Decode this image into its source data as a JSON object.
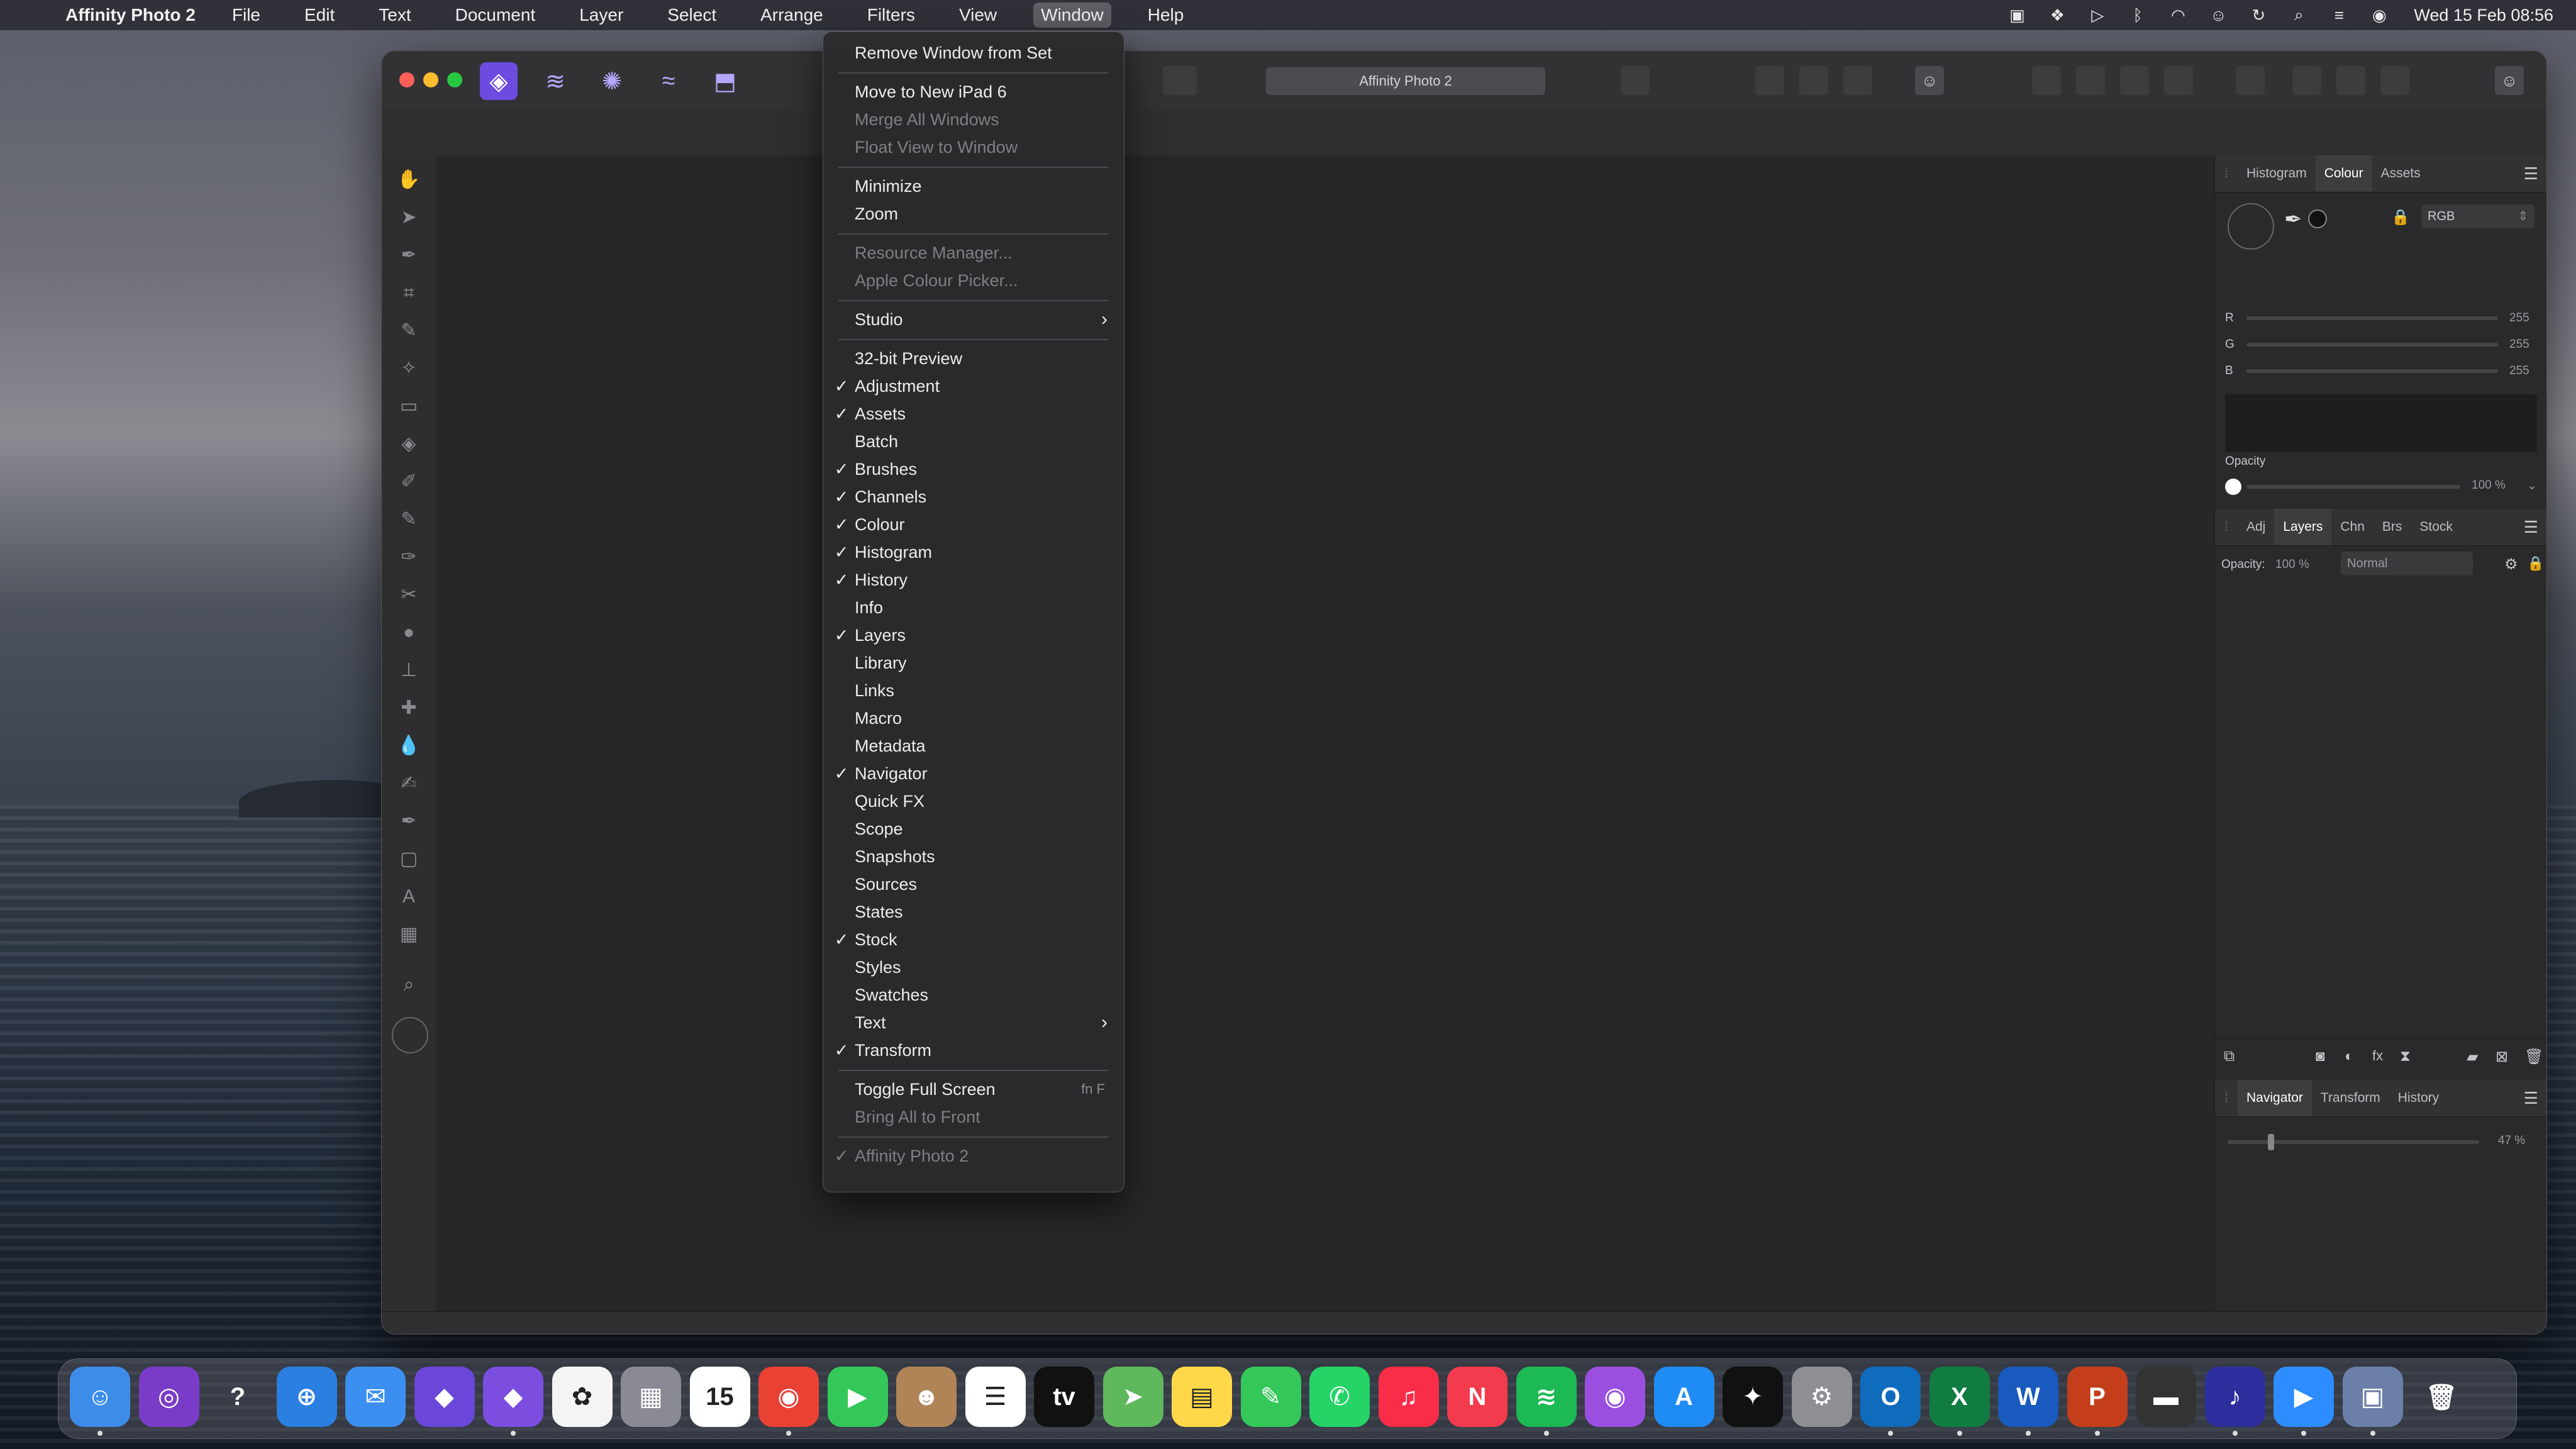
{
  "menubar": {
    "app_name": "Affinity Photo 2",
    "menus": [
      "File",
      "Edit",
      "Text",
      "Document",
      "Layer",
      "Select",
      "Arrange",
      "Filters",
      "View",
      "Window",
      "Help"
    ],
    "open_menu": "Window",
    "clock": "Wed 15 Feb  08:56"
  },
  "window": {
    "title": "Affinity Photo 2"
  },
  "colour_panel": {
    "tabs": [
      "Histogram",
      "Colour",
      "Assets"
    ],
    "selected_tab": "Colour",
    "model": "RGB",
    "channels": [
      {
        "label": "R",
        "value": "255"
      },
      {
        "label": "G",
        "value": "255"
      },
      {
        "label": "B",
        "value": "255"
      }
    ],
    "opacity_label": "Opacity",
    "opacity_value": "100 %"
  },
  "layers_panel": {
    "tabs": [
      "Adj",
      "Layers",
      "Chn",
      "Brs",
      "Stock"
    ],
    "selected_tab": "Layers",
    "opacity_label": "Opacity:",
    "opacity_value": "100 %",
    "blend_mode": "Normal"
  },
  "navigator_panel": {
    "tabs": [
      "Navigator",
      "Transform",
      "History"
    ],
    "selected_tab": "Navigator",
    "zoom": "47 %"
  },
  "window_menu": {
    "items": [
      {
        "label": "Remove Window from Set",
        "checked": false,
        "disabled": false
      },
      {
        "separator": true
      },
      {
        "label": "Move to New iPad 6",
        "checked": false,
        "disabled": false
      },
      {
        "label": "Merge All Windows",
        "checked": false,
        "disabled": true
      },
      {
        "label": "Float View to Window",
        "checked": false,
        "disabled": true
      },
      {
        "separator": true
      },
      {
        "label": "Minimize",
        "checked": false,
        "disabled": false
      },
      {
        "label": "Zoom",
        "checked": false,
        "disabled": false
      },
      {
        "separator": true
      },
      {
        "label": "Resource Manager...",
        "checked": false,
        "disabled": true
      },
      {
        "label": "Apple Colour Picker...",
        "checked": false,
        "disabled": true
      },
      {
        "separator": true
      },
      {
        "label": "Studio",
        "checked": false,
        "disabled": false,
        "submenu": true
      },
      {
        "separator": true
      },
      {
        "label": "32-bit Preview",
        "checked": false,
        "disabled": false
      },
      {
        "label": "Adjustment",
        "checked": true,
        "disabled": false
      },
      {
        "label": "Assets",
        "checked": true,
        "disabled": false
      },
      {
        "label": "Batch",
        "checked": false,
        "disabled": false
      },
      {
        "label": "Brushes",
        "checked": true,
        "disabled": false
      },
      {
        "label": "Channels",
        "checked": true,
        "disabled": false
      },
      {
        "label": "Colour",
        "checked": true,
        "disabled": false
      },
      {
        "label": "Histogram",
        "checked": true,
        "disabled": false
      },
      {
        "label": "History",
        "checked": true,
        "disabled": false
      },
      {
        "label": "Info",
        "checked": false,
        "disabled": false
      },
      {
        "label": "Layers",
        "checked": true,
        "disabled": false
      },
      {
        "label": "Library",
        "checked": false,
        "disabled": false
      },
      {
        "label": "Links",
        "checked": false,
        "disabled": false
      },
      {
        "label": "Macro",
        "checked": false,
        "disabled": false
      },
      {
        "label": "Metadata",
        "checked": false,
        "disabled": false
      },
      {
        "label": "Navigator",
        "checked": true,
        "disabled": false
      },
      {
        "label": "Quick FX",
        "checked": false,
        "disabled": false
      },
      {
        "label": "Scope",
        "checked": false,
        "disabled": false
      },
      {
        "label": "Snapshots",
        "checked": false,
        "disabled": false
      },
      {
        "label": "Sources",
        "checked": false,
        "disabled": false
      },
      {
        "label": "States",
        "checked": false,
        "disabled": false
      },
      {
        "label": "Stock",
        "checked": true,
        "disabled": false
      },
      {
        "label": "Styles",
        "checked": false,
        "disabled": false
      },
      {
        "label": "Swatches",
        "checked": false,
        "disabled": false
      },
      {
        "label": "Text",
        "checked": false,
        "disabled": false,
        "submenu": true
      },
      {
        "label": "Transform",
        "checked": true,
        "disabled": false
      },
      {
        "separator": true
      },
      {
        "label": "Toggle Full Screen",
        "checked": false,
        "disabled": false,
        "shortcut": "fn F"
      },
      {
        "label": "Bring All to Front",
        "checked": false,
        "disabled": true
      },
      {
        "separator": true
      },
      {
        "label": "Affinity Photo 2",
        "checked": true,
        "disabled": true
      }
    ]
  },
  "dock": {
    "items": [
      {
        "name": "finder-icon",
        "color": "#3d8de8",
        "glyph": "☺",
        "running": true
      },
      {
        "name": "siri-icon",
        "color": "#7a3cc8",
        "glyph": "◎",
        "running": false
      },
      {
        "name": "help-icon",
        "color": "transparent",
        "glyph": "?",
        "running": false
      },
      {
        "name": "safari-icon",
        "color": "#2a7fe0",
        "glyph": "⊕",
        "running": false
      },
      {
        "name": "mail-icon",
        "color": "#3b8ff0",
        "glyph": "✉",
        "running": false
      },
      {
        "name": "affinity-designer-icon",
        "color": "#6a47d8",
        "glyph": "◆",
        "running": false
      },
      {
        "name": "affinity-photo-icon",
        "color": "#7b4ee0",
        "glyph": "◆",
        "running": true
      },
      {
        "name": "photos-icon",
        "color": "#f4f4f4",
        "glyph": "✿",
        "running": false
      },
      {
        "name": "launchpad-icon",
        "color": "#8a8a94",
        "glyph": "▦",
        "running": false
      },
      {
        "name": "calendar-icon",
        "color": "#ffffff",
        "glyph": "15",
        "running": false
      },
      {
        "name": "chrome-icon",
        "color": "#e94235",
        "glyph": "◉",
        "running": true
      },
      {
        "name": "facetime-icon",
        "color": "#34c759",
        "glyph": "▶",
        "running": false
      },
      {
        "name": "contacts-icon",
        "color": "#b08457",
        "glyph": "☻",
        "running": false
      },
      {
        "name": "reminders-icon",
        "color": "#ffffff",
        "glyph": "☰",
        "running": false
      },
      {
        "name": "appletv-icon",
        "color": "#111111",
        "glyph": "tv",
        "running": false
      },
      {
        "name": "maps-icon",
        "color": "#5fb85b",
        "glyph": "➤",
        "running": false
      },
      {
        "name": "notes-icon",
        "color": "#ffd84a",
        "glyph": "▤",
        "running": false
      },
      {
        "name": "messages-icon",
        "color": "#34c759",
        "glyph": "✎",
        "running": false
      },
      {
        "name": "whatsapp-icon",
        "color": "#25d366",
        "glyph": "✆",
        "running": false
      },
      {
        "name": "music-icon",
        "color": "#fa2d48",
        "glyph": "♫",
        "running": false
      },
      {
        "name": "news-icon",
        "color": "#f43b4e",
        "glyph": "N",
        "running": false
      },
      {
        "name": "spotify-icon",
        "color": "#1db954",
        "glyph": "≋",
        "running": true
      },
      {
        "name": "podcasts-icon",
        "color": "#9b4fe0",
        "glyph": "◉",
        "running": false
      },
      {
        "name": "appstore-icon",
        "color": "#1f8cf5",
        "glyph": "A",
        "running": false
      },
      {
        "name": "keeper-icon",
        "color": "#111111",
        "glyph": "✦",
        "running": false
      },
      {
        "name": "system-settings-icon",
        "color": "#8e8e93",
        "glyph": "⚙",
        "running": false
      },
      {
        "name": "outlook-icon",
        "color": "#0f6cbd",
        "glyph": "O",
        "running": true
      },
      {
        "name": "excel-icon",
        "color": "#107c41",
        "glyph": "X",
        "running": true
      },
      {
        "name": "word-icon",
        "color": "#185abd",
        "glyph": "W",
        "running": true
      },
      {
        "name": "powerpoint-icon",
        "color": "#c43e1c",
        "glyph": "P",
        "running": true
      },
      {
        "name": "device-icon",
        "color": "#333333",
        "glyph": "▬",
        "running": false
      },
      {
        "name": "amazon-music-icon",
        "color": "#2d2f9e",
        "glyph": "♪",
        "running": true
      },
      {
        "name": "zoom-icon",
        "color": "#2d8cff",
        "glyph": "▶",
        "running": true
      },
      {
        "name": "preview-icon",
        "color": "#6b7fa8",
        "glyph": "▣",
        "running": true
      },
      {
        "name": "trash-icon",
        "color": "transparent",
        "glyph": "🗑",
        "running": false
      }
    ]
  }
}
